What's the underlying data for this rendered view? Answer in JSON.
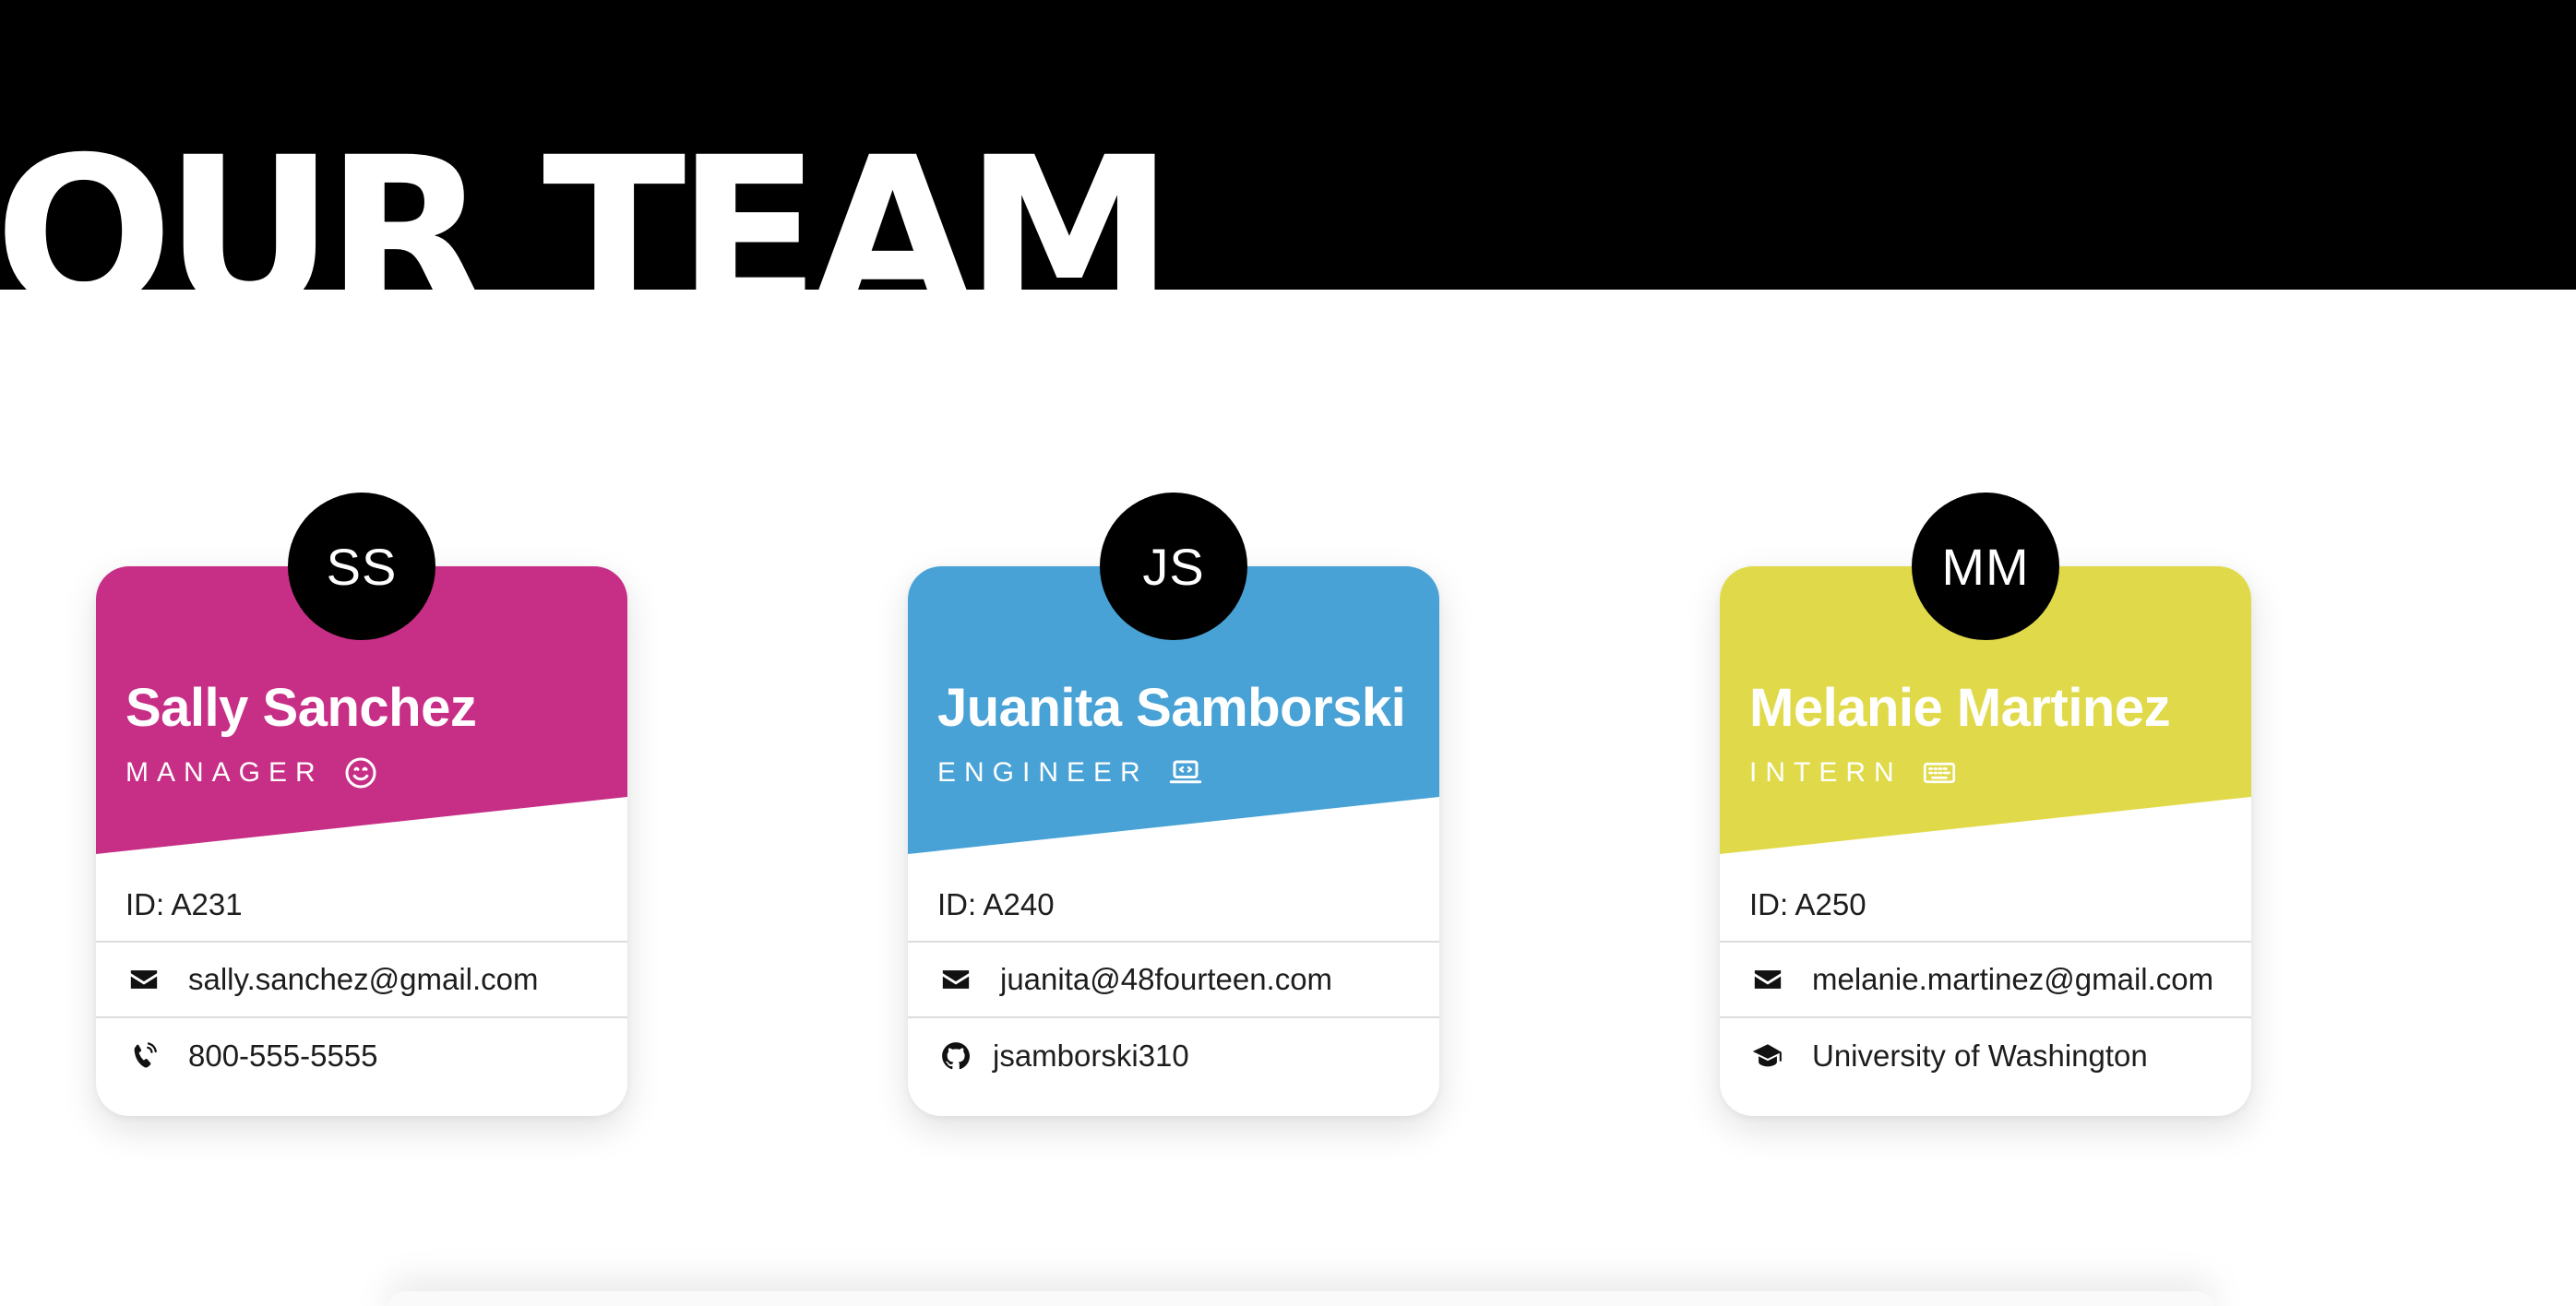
{
  "header": {
    "title": "OUR TEAM",
    "background": "#000000"
  },
  "cards": [
    {
      "initials": "SS",
      "name": "Sally Sanchez",
      "role": "MANAGER",
      "role_icon": "smile-icon",
      "accent": "#c72f86",
      "id_text": "ID: A231",
      "row2": {
        "icon": "envelope-icon",
        "text": "sally.sanchez@gmail.com"
      },
      "row3": {
        "icon": "phone-icon",
        "text": "800-555-5555"
      }
    },
    {
      "initials": "JS",
      "name": "Juanita Samborski",
      "role": "ENGINEER",
      "role_icon": "laptop-code-icon",
      "accent": "#48a2d6",
      "id_text": "ID: A240",
      "row2": {
        "icon": "envelope-icon",
        "text": "juanita@48fourteen.com"
      },
      "row3": {
        "icon": "github-icon",
        "text": "jsamborski310"
      }
    },
    {
      "initials": "MM",
      "name": "Melanie Martinez",
      "role": "INTERN",
      "role_icon": "keyboard-icon",
      "accent": "#e0da4a",
      "id_text": "ID: A250",
      "row2": {
        "icon": "envelope-icon",
        "text": "melanie.martinez@gmail.com"
      },
      "row3": {
        "icon": "graduation-cap-icon",
        "text": "University of Washington"
      }
    }
  ]
}
